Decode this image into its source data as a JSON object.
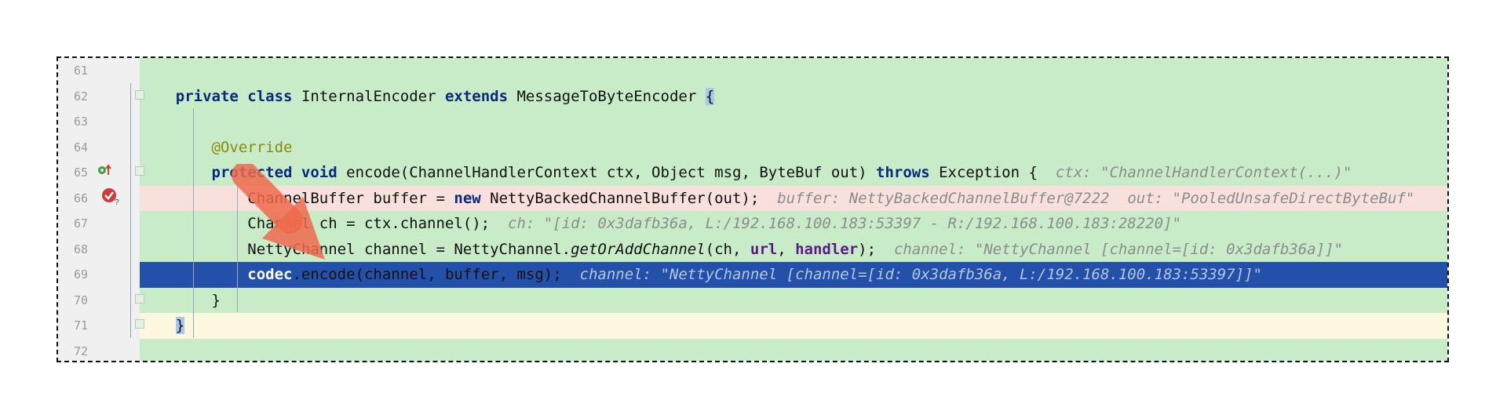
{
  "editor": {
    "lines": [
      {
        "num": "61",
        "code": []
      },
      {
        "num": "62",
        "code": [
          {
            "t": "    "
          },
          {
            "t": "private",
            "c": "kw"
          },
          {
            "t": " "
          },
          {
            "t": "class",
            "c": "kw"
          },
          {
            "t": " InternalEncoder "
          },
          {
            "t": "extends",
            "c": "kw"
          },
          {
            "t": " MessageToByteEncoder "
          },
          {
            "t": "{",
            "c": "brace-hl"
          }
        ]
      },
      {
        "num": "63",
        "code": []
      },
      {
        "num": "64",
        "code": [
          {
            "t": "        "
          },
          {
            "t": "@Override",
            "c": "ann"
          }
        ]
      },
      {
        "num": "65",
        "code": [
          {
            "t": "        "
          },
          {
            "t": "protected",
            "c": "kw"
          },
          {
            "t": " "
          },
          {
            "t": "void",
            "c": "kw"
          },
          {
            "t": " encode(ChannelHandlerContext ctx, Object msg, ByteBuf out) "
          },
          {
            "t": "throws",
            "c": "kw"
          },
          {
            "t": " Exception {  "
          },
          {
            "t": "ctx: \"ChannelHandlerContext(...)\"",
            "c": "hint"
          }
        ]
      },
      {
        "num": "66",
        "code": [
          {
            "t": "            ChannelBuffer buffer = "
          },
          {
            "t": "new",
            "c": "kw"
          },
          {
            "t": " NettyBackedChannelBuffer(out);  "
          },
          {
            "t": "buffer: NettyBackedChannelBuffer@7222  out: \"PooledUnsafeDirectByteBuf\"",
            "c": "hint"
          }
        ]
      },
      {
        "num": "67",
        "code": [
          {
            "t": "            Channel ch = ctx.channel();  "
          },
          {
            "t": "ch: \"[id: 0x3dafb36a, L:/192.168.100.183:53397 - R:/192.168.100.183:28220]\"",
            "c": "hint"
          }
        ]
      },
      {
        "num": "68",
        "code": [
          {
            "t": "            NettyChannel channel = NettyChannel."
          },
          {
            "t": "getOrAddChannel",
            "c": "italic"
          },
          {
            "t": "(ch, "
          },
          {
            "t": "url",
            "c": "field"
          },
          {
            "t": ", "
          },
          {
            "t": "handler",
            "c": "field"
          },
          {
            "t": ");  "
          },
          {
            "t": "channel: \"NettyChannel [channel=[id: 0x3dafb36a]]\"",
            "c": "hint"
          }
        ]
      },
      {
        "num": "69",
        "code": [
          {
            "t": "            "
          },
          {
            "t": "codec",
            "c": "field"
          },
          {
            "t": ".encode(channel, buffer, msg);  "
          },
          {
            "t": "channel: \"NettyChannel [channel=[id: 0x3dafb36a, L:/192.168.100.183:53397]]\"",
            "c": "hint"
          }
        ]
      },
      {
        "num": "70",
        "code": [
          {
            "t": "        }"
          }
        ]
      },
      {
        "num": "71",
        "code": [
          {
            "t": "    "
          },
          {
            "t": "}",
            "c": "brace-hl"
          }
        ]
      },
      {
        "num": "72",
        "code": []
      }
    ],
    "line_backgrounds": [
      "bg-green",
      "bg-green",
      "bg-green",
      "bg-green",
      "bg-green",
      "bg-red",
      "bg-green",
      "bg-green",
      "bg-sel",
      "bg-green",
      "bg-cream",
      "bg-green"
    ],
    "current_line_index": 8,
    "breakpoint_line_index": 5,
    "override_marker_line_index": 4
  },
  "colors": {
    "keyword": "#0b2782",
    "annotation": "#8a8a12",
    "selection": "#2350a9",
    "breakpoint_line": "#f8e1dc",
    "coverage_green": "#c7ecc7",
    "caret_line": "#fdf7df",
    "debug_arrow": "#f06a4c"
  },
  "icons": {
    "override": "override-gutter-icon",
    "breakpoint": "breakpoint-icon",
    "execution_pointer": "execution-pointer-arrow-icon"
  }
}
